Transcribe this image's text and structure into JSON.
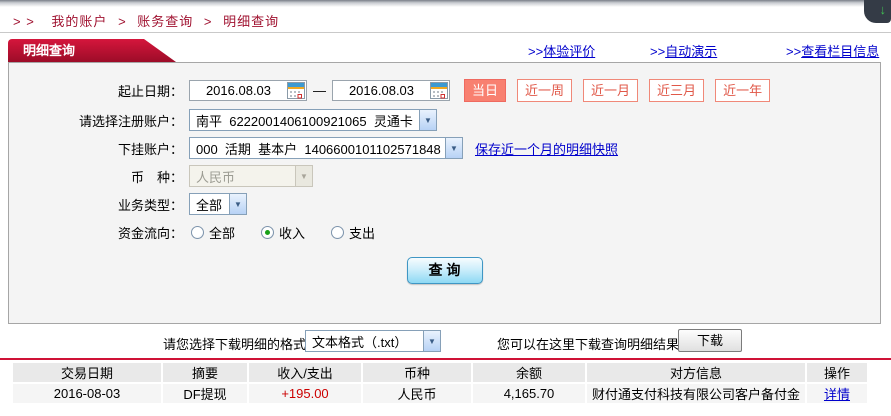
{
  "breadcrumb": {
    "prefix": "> >",
    "separator": ">",
    "items": [
      "我的账户",
      "账务查询",
      "明细查询"
    ]
  },
  "tab_title": "明细查询",
  "header_links": [
    {
      "prefix": ">>",
      "label": "体验评价"
    },
    {
      "prefix": ">>",
      "label": "自动演示"
    },
    {
      "prefix": ">>",
      "label": "查看栏目信息"
    }
  ],
  "corner_widget": {
    "arrow": "↓"
  },
  "form": {
    "date_label": "起止日期：",
    "date_from": "2016.08.03",
    "date_to": "2016.08.03",
    "date_separator": "—",
    "quick_buttons": [
      {
        "label": "当日",
        "active": true
      },
      {
        "label": "近一周",
        "active": false
      },
      {
        "label": "近一月",
        "active": false
      },
      {
        "label": "近三月",
        "active": false
      },
      {
        "label": "近一年",
        "active": false
      }
    ],
    "account_label": "请选择注册账户：",
    "account_value": "南平  6222001406100921065  灵通卡",
    "sub_account_label": "下挂账户：",
    "sub_account_value": "000  活期  基本户  1406600101102571848",
    "snapshot_link": "保存近一个月的明细快照",
    "currency_label": "币　种：",
    "currency_value": "人民币",
    "biz_type_label": "业务类型：",
    "biz_type_value": "全部",
    "flow_label": "资金流向：",
    "flow_options": [
      {
        "label": "全部",
        "checked": false
      },
      {
        "label": "收入",
        "checked": true
      },
      {
        "label": "支出",
        "checked": false
      }
    ],
    "query_button": "查 询"
  },
  "download": {
    "format_label": "请您选择下载明细的格式",
    "format_value": "文本格式（.txt）",
    "hint": "您可以在这里下载查询明细结果",
    "button": "下载"
  },
  "table": {
    "headers": [
      "交易日期",
      "摘要",
      "收入/支出",
      "币种",
      "余额",
      "对方信息",
      "操作"
    ],
    "rows": [
      {
        "date": "2016-08-03",
        "summary": "DF提现",
        "amount": "+195.00",
        "currency": "人民币",
        "balance": "4,165.70",
        "counterparty": "财付通支付科技有限公司客户备付金",
        "action": "详情"
      }
    ]
  },
  "colors": {
    "brand_red": "#a01230",
    "tab_red": "#b31133",
    "link_blue": "#0000cc",
    "amount_red": "#cc0000",
    "accent_salmon": "#f88070",
    "query_blue": "#8ed9f4"
  }
}
